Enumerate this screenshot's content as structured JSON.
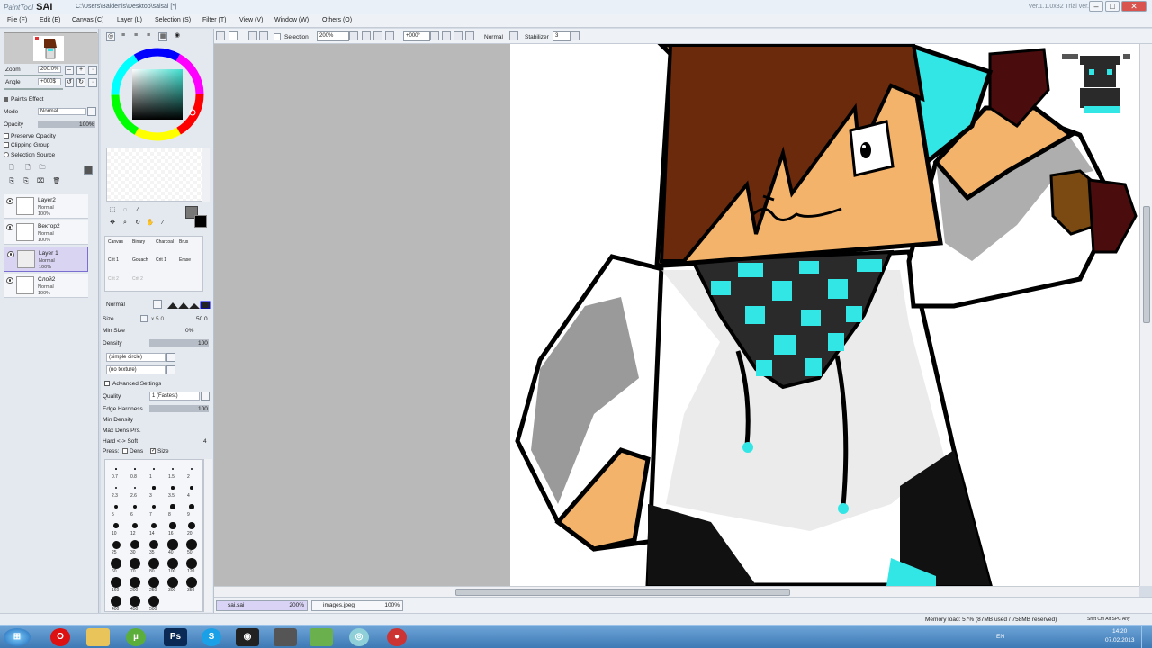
{
  "title_bar": {
    "app": "PaintTool",
    "app_sai": "SAI",
    "file_path": "C:\\Users\\Baldenis\\Desktop\\saisai [*]",
    "version": "Ver.1.1.0x32 Trial ver.",
    "min_icon": "minimize-icon",
    "max_icon": "maximize-icon",
    "close_icon": "close-icon"
  },
  "menu": [
    "File (F)",
    "Edit (E)",
    "Canvas (C)",
    "Layer (L)",
    "Selection (S)",
    "Filter (T)",
    "View (V)",
    "Window (W)",
    "Others (O)"
  ],
  "toolbar": {
    "selection_label": "Selection",
    "zoom": "200%",
    "rotation": "+000°",
    "mode": "Normal",
    "stabilizer_label": "Stabilizer",
    "stabilizer_value": "3"
  },
  "navigator": {
    "zoom_label": "Zoom",
    "zoom_value": "200.0%",
    "angle_label": "Angle",
    "angle_value": "+000$"
  },
  "layer_panel": {
    "paint_effect": "Paints Effect",
    "mode_label": "Mode",
    "mode_value": "Normal",
    "opacity_label": "Opacity",
    "opacity_value": "100%",
    "preserve_opacity": "Preserve Opacity",
    "clipping_group": "Clipping Group",
    "selection_source": "Selection Source",
    "layers": [
      {
        "name": "Layer2",
        "mode": "Normal",
        "opacity": "100%"
      },
      {
        "name": "Вектор2",
        "mode": "Normal",
        "opacity": "100%"
      },
      {
        "name": "Layer 1",
        "mode": "Normal",
        "opacity": "100%"
      },
      {
        "name": "Слой2",
        "mode": "Normal",
        "opacity": "100%"
      }
    ]
  },
  "brush_tools": {
    "row1": [
      "Canvas",
      "Binary",
      "Charcoal",
      "Brus"
    ],
    "row2": [
      "Crit 1",
      "Gouach",
      "Crit 1",
      "Erase"
    ],
    "row3": [
      "Crit 2",
      "Crit 2",
      "",
      ""
    ],
    "blend_mode": "Normal",
    "size_label": "Size",
    "size_mult": "x 5.0",
    "size_value": "50.0",
    "min_size_label": "Min Size",
    "min_size_value": "0%",
    "density_label": "Density",
    "density_value": "100",
    "shape": "(simple circle)",
    "texture": "(no texture)",
    "advanced": "Advanced Settings",
    "quality_label": "Quality",
    "quality_value": "1 (Fastest)",
    "edge_label": "Edge Hardness",
    "edge_value": "100",
    "min_density_label": "Min Density",
    "max_dens_label": "Max Dens Prs.",
    "hard_soft_label": "Hard <-> Soft",
    "hard_soft_value": "4",
    "press_label": "Press:",
    "dens_label": "Dens",
    "size_chk_label": "Size",
    "sizes": [
      "0.7",
      "0.8",
      "1",
      "1.5",
      "2",
      "2.3",
      "2.6",
      "3",
      "3.5",
      "4",
      "5",
      "6",
      "7",
      "8",
      "9",
      "10",
      "12",
      "14",
      "16",
      "20",
      "25",
      "30",
      "35",
      "40",
      "50",
      "60",
      "70",
      "80",
      "100",
      "120",
      "160",
      "200",
      "250",
      "300",
      "350",
      "400",
      "450",
      "500"
    ]
  },
  "documents": [
    {
      "name": "sai.sai",
      "zoom": "200%"
    },
    {
      "name": "images.jpeg",
      "zoom": "100%"
    }
  ],
  "status": {
    "memory": "Memory load: 57% (87MB used / 758MB reserved)",
    "keys": "Shift Ctrl Alt SPC Any"
  },
  "taskbar": {
    "lang": "EN",
    "time": "14:20",
    "date": "07.02.2013",
    "apps": [
      "start-orb-icon",
      "opera-icon",
      "explorer-icon",
      "utorrent-icon",
      "photoshop-icon",
      "skype-icon",
      "steam-icon",
      "game-icon",
      "minecraft-icon",
      "app-icon",
      "chrome-icon"
    ]
  },
  "colors": {
    "hair": "#6b2a0c",
    "skin": "#f4b36a",
    "cyan": "#33e6e6",
    "dark_teal": "#1d4a4a",
    "shirt": "#ffffff",
    "grey": "#9a9a9a"
  }
}
